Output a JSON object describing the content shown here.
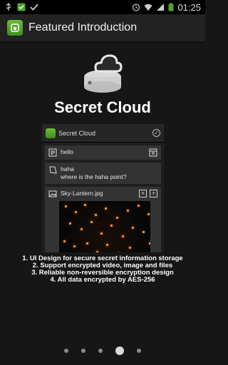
{
  "status_bar": {
    "time": "01:25",
    "left_icons": [
      "usb-icon",
      "shield-check-icon",
      "check-icon"
    ],
    "right_icons": [
      "alarm-icon",
      "wifi-icon",
      "signal-icon",
      "battery-icon"
    ]
  },
  "title_bar": {
    "title": "Featured Introduction"
  },
  "hero": {
    "title": "Secret Cloud",
    "icon": "cloud-drive-icon"
  },
  "preview": {
    "header_title": "Secret Cloud",
    "items": [
      {
        "icon": "note-icon",
        "text": "hello"
      },
      {
        "icon": "pencil-icon",
        "line1": "haha",
        "line2": "where is the haha point?"
      },
      {
        "icon": "image-icon",
        "text": "Sky-Lantern.jpg"
      }
    ]
  },
  "features": [
    "1. UI Design for secure secret information storage",
    "2. Support encrypted video, image and files",
    "3. Reliable non-reversible encryption design",
    "4. All data encrypted by AES-256"
  ],
  "pager": {
    "total": 5,
    "active_index": 3
  },
  "colors": {
    "accent_green": "#4fa52a",
    "background": "#161616"
  }
}
